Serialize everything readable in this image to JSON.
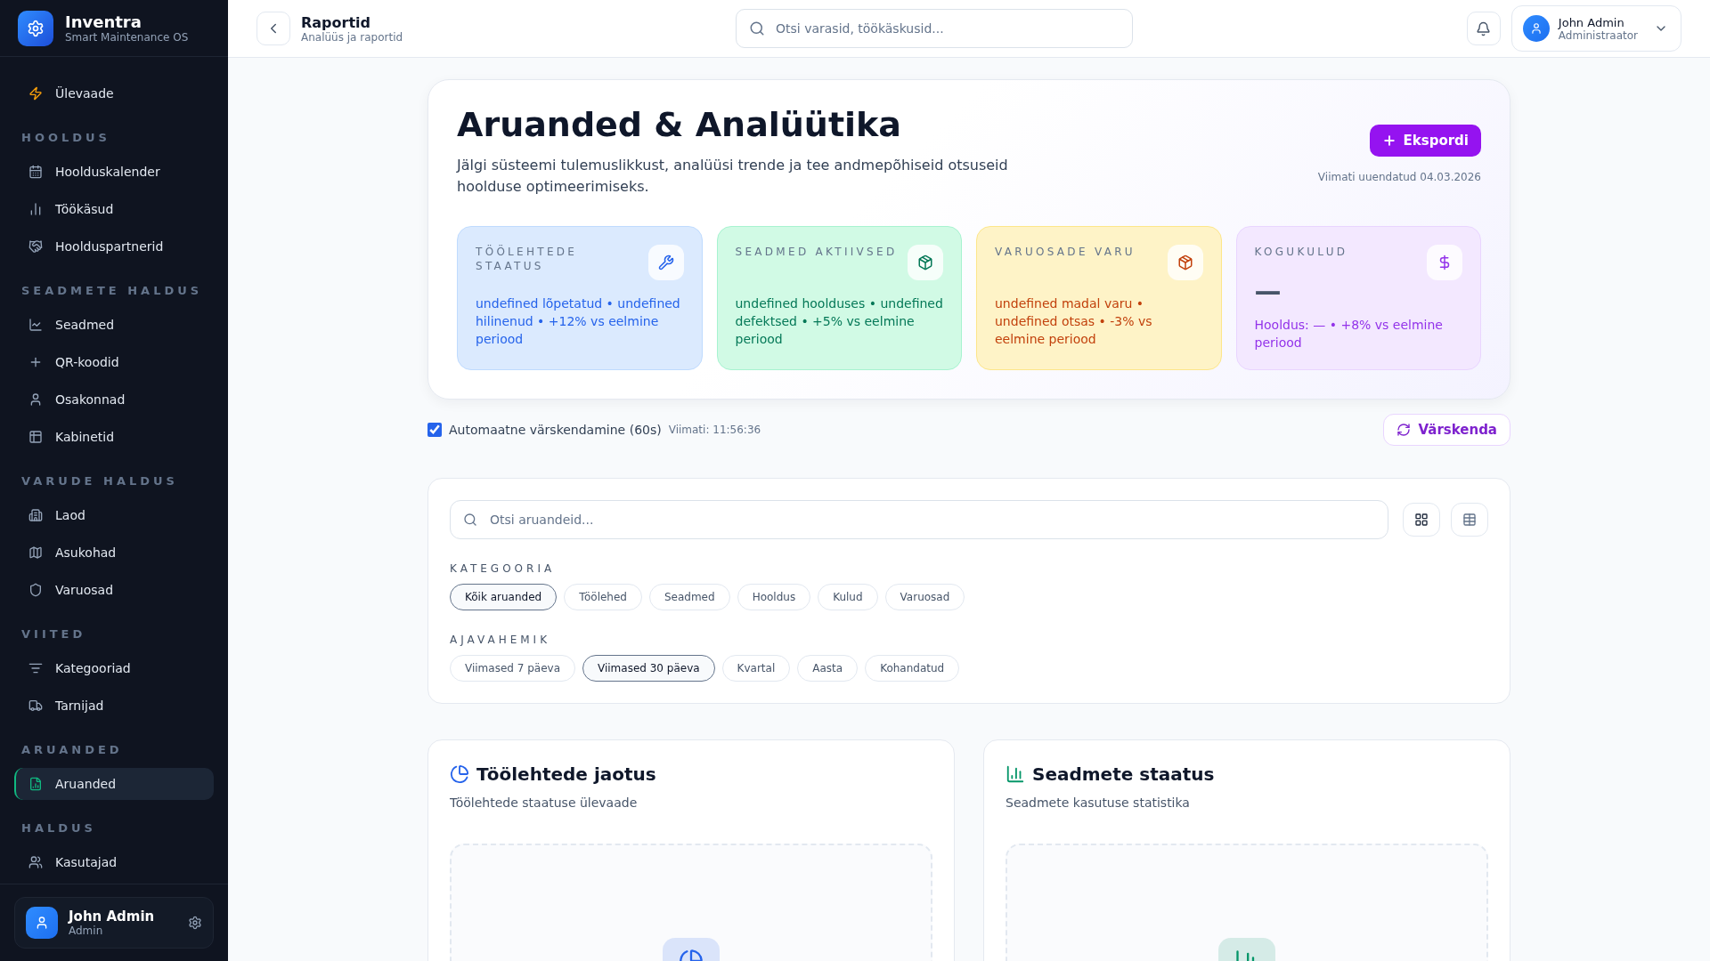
{
  "app": {
    "name": "Inventra",
    "tagline": "Smart Maintenance OS"
  },
  "sidebar": {
    "groups": [
      {
        "items": [
          {
            "label": "Ülevaade",
            "selected": false
          }
        ]
      },
      {
        "heading": "HOOLDUS",
        "items": [
          {
            "label": "Hoolduskalender",
            "selected": false
          },
          {
            "label": "Töökäsud",
            "selected": false
          },
          {
            "label": "Hoolduspartnerid",
            "selected": false
          }
        ]
      },
      {
        "heading": "SEADMETE HALDUS",
        "items": [
          {
            "label": "Seadmed",
            "selected": false
          },
          {
            "label": "QR-koodid",
            "selected": false
          },
          {
            "label": "Osakonnad",
            "selected": false
          },
          {
            "label": "Kabinetid",
            "selected": false
          }
        ]
      },
      {
        "heading": "VARUDE HALDUS",
        "items": [
          {
            "label": "Laod",
            "selected": false
          },
          {
            "label": "Asukohad",
            "selected": false
          },
          {
            "label": "Varuosad",
            "selected": false
          }
        ]
      },
      {
        "heading": "VIITED",
        "items": [
          {
            "label": "Kategooriad",
            "selected": false
          },
          {
            "label": "Tarnijad",
            "selected": false
          }
        ]
      },
      {
        "heading": "ARUANDED",
        "items": [
          {
            "label": "Aruanded",
            "selected": true
          }
        ]
      },
      {
        "heading": "HALDUS",
        "items": [
          {
            "label": "Kasutajad",
            "selected": false
          }
        ]
      }
    ],
    "user": {
      "name": "John Admin",
      "role": "Admin"
    }
  },
  "header": {
    "title": "Raportid",
    "subtitle": "Analüüs ja raportid",
    "search": {
      "placeholder": "Otsi varasid, töökäskusid..."
    },
    "user": {
      "name": "John Admin",
      "role": "Administraator"
    }
  },
  "hero": {
    "title": "Aruanded & Analüütika",
    "description": "Jälgi süsteemi tulemuslikkust, analüüsi trende ja tee andmepõhiseid otsuseid hoolduse optimeerimiseks.",
    "export_button": "Ekspordi",
    "updated": "Viimati uuendatud 04.03.2026",
    "stats": [
      {
        "label": "TÖÖLEHTEDE STAATUS",
        "color": "#2563eb",
        "detail": "undefined lõpetatud • undefined hilinenud • +12% vs eelmine periood"
      },
      {
        "label": "SEADMED AKTIIVSED",
        "color": "#047857",
        "detail": "undefined hoolduses • undefined defektsed • +5% vs eelmine periood"
      },
      {
        "label": "VARUOSADE VARU",
        "color": "#c2410c",
        "detail": "undefined madal varu • undefined otsas • -3% vs eelmine periood"
      },
      {
        "label": "KOGUKULUD",
        "color": "#9333ea",
        "value": "—",
        "detail": "Hooldus: — • +8% vs eelmine periood"
      }
    ]
  },
  "auto_refresh": {
    "label": "Automaatne värskendamine (60s)",
    "checked": true,
    "last": "Viimati: 11:56:36",
    "button": "Värskenda"
  },
  "filters": {
    "search": {
      "placeholder": "Otsi aruandeid..."
    },
    "groups": [
      {
        "heading": "KATEGOORIA",
        "options": [
          {
            "label": "Kõik aruanded",
            "selected": true
          },
          {
            "label": "Töölehed",
            "selected": false
          },
          {
            "label": "Seadmed",
            "selected": false
          },
          {
            "label": "Hooldus",
            "selected": false
          },
          {
            "label": "Kulud",
            "selected": false
          },
          {
            "label": "Varuosad",
            "selected": false
          }
        ]
      },
      {
        "heading": "AJAVAHEMIK",
        "options": [
          {
            "label": "Viimased 7 päeva",
            "selected": false
          },
          {
            "label": "Viimased 30 päeva",
            "selected": true
          },
          {
            "label": "Kvartal",
            "selected": false
          },
          {
            "label": "Aasta",
            "selected": false
          },
          {
            "label": "Kohandatud",
            "selected": false
          }
        ]
      }
    ]
  },
  "panels": [
    {
      "title": "Töölehtede jaotus",
      "subtitle": "Töölehtede staatuse ülevaade",
      "color": "#2563eb"
    },
    {
      "title": "Seadmete staatus",
      "subtitle": "Seadmete kasutuse statistika",
      "color": "#059669"
    }
  ]
}
